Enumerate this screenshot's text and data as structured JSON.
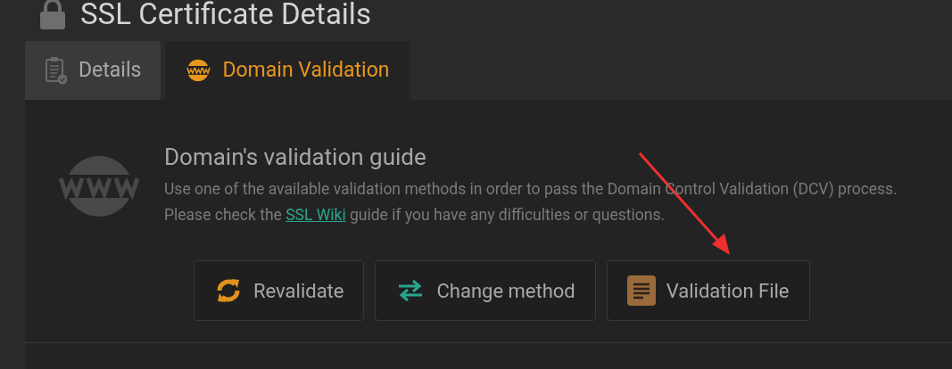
{
  "page": {
    "title": "SSL Certificate Details"
  },
  "tabs": [
    {
      "label": "Details",
      "selected": false
    },
    {
      "label": "Domain Validation",
      "selected": true
    }
  ],
  "guide": {
    "heading": "Domain's validation guide",
    "text_before": "Use one of the available validation methods in order to pass the Domain Control Validation (DCV) process. Please check the",
    "link": "SSL Wiki",
    "text_after": "guide if you have any difficulties or questions."
  },
  "buttons": [
    {
      "label": "Revalidate"
    },
    {
      "label": "Change method"
    },
    {
      "label": "Validation File"
    }
  ]
}
